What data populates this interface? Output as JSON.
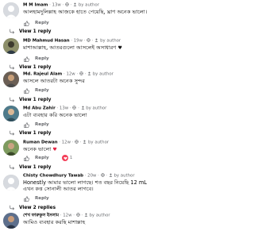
{
  "comments": [
    {
      "author": "M M Imam",
      "time": "13w",
      "by_author": "by author",
      "text": "আলহামদুলিল্লাহ আজকে হাতে পেয়েছি, ঘ্রাণ অনেক ভালো।",
      "reply_label": "Reply",
      "view_replies": "View 1 reply",
      "avatar_color": "#d7dadf"
    },
    {
      "author": "MD Mahmud Hasan",
      "time": "19w",
      "by_author": "by author",
      "text": "মাশাআল্লাহ, আতরগুলো আসলেই অসাধারণ",
      "reply_label": "Reply",
      "view_replies": "View 1 reply",
      "avatar_color": "#8d8f6a"
    },
    {
      "author": "Md. Rajeul Alam",
      "time": "12w",
      "by_author": "by author",
      "text": "আসলে আতরটা অনেক সুন্দর",
      "reply_label": "Reply",
      "view_replies": "View 1 reply",
      "avatar_color": "#6b5f55"
    },
    {
      "author": "Md Abu Zahir",
      "time": "13w",
      "by_author": "by author",
      "text": "এটা ব্যবহার করি অনেক ভালো",
      "reply_label": "Reply",
      "view_replies": "View 1 reply",
      "avatar_color": "#4e7a8a"
    },
    {
      "author": "Ruman Dewan",
      "time": "12w",
      "by_author": "by author",
      "text": "অনেক ভালো",
      "reaction_count": "1",
      "reply_label": "Reply",
      "view_replies": "View 1 reply",
      "avatar_color": "#7d9a5e"
    },
    {
      "author": "Chisty Chowdhury Tawab",
      "time": "20w",
      "by_author": "by author",
      "text_line1": "Honestly আমার ভালো লাগছে। শত বছর নিয়েছি 12 mL",
      "text_line2": "এখন কত্ত সোনালী আতর লাগবে।",
      "reply_label": "Reply",
      "view_replies": "View 2 replies",
      "avatar_color": "#d7dadf"
    },
    {
      "author": "শেখ ফারুকুল ইসলাম",
      "time": "12w",
      "by_author": "by author",
      "text": "আমিও ব্যবহার করছি মাশাল্লাহ",
      "avatar_color": "#5d6f8c"
    }
  ],
  "colors": {
    "meta_gray": "#65676b",
    "heart_red": "#f33e58"
  }
}
